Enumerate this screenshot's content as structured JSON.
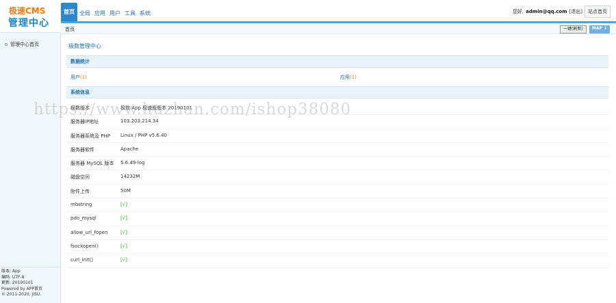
{
  "logo": {
    "line1": "极速CMS",
    "line2": "管理中心"
  },
  "nav": {
    "tabs": [
      "首页",
      "全局",
      "应用",
      "用户",
      "工具",
      "系统"
    ]
  },
  "user_bar": {
    "greeting": "您好,",
    "email": "admin@qq.com",
    "logout": "[退出]",
    "site_home": "站点首页"
  },
  "breadcrumb": {
    "text": "首页"
  },
  "toolbar": {
    "one_click": "一键(刷新)",
    "map": "MAP ⇓"
  },
  "sidebar": {
    "item": "管理中心首页",
    "info": [
      "版本: App",
      "编码: UTF-8",
      "更新: 20190101",
      "Powered by APP首页",
      "© 2011-2020, JISU."
    ]
  },
  "main": {
    "title": "极数管理中心",
    "stats_title": "数据统计",
    "stats": [
      {
        "label": "用户",
        "count": "(1)"
      },
      {
        "label": "应用",
        "count": "(1)"
      }
    ],
    "sys_title": "系统信息",
    "rows": [
      {
        "label": "极数版本",
        "value": "极数 App 极速版版本 20190101",
        "ok": false
      },
      {
        "label": "服务器IP地址",
        "value": "103.203.214.34",
        "ok": false
      },
      {
        "label": "服务器系统及 PHP",
        "value": "Linux / PHP v5.6.40",
        "ok": false
      },
      {
        "label": "服务器软件",
        "value": "Apache",
        "ok": false
      },
      {
        "label": "服务器 MySQL 版本",
        "value": "5.6.49-log",
        "ok": false
      },
      {
        "label": "磁盘空间",
        "value": "14232M",
        "ok": false
      },
      {
        "label": "附件上传",
        "value": "50M",
        "ok": false
      },
      {
        "label": "mbstring",
        "value": "[√]",
        "ok": true
      },
      {
        "label": "pdo_mysql",
        "value": "[√]",
        "ok": true
      },
      {
        "label": "allow_url_fopen",
        "value": "[√]",
        "ok": true
      },
      {
        "label": "fsockopen()",
        "value": "[√]",
        "ok": true
      },
      {
        "label": "curl_init()",
        "value": "[√]",
        "ok": true
      }
    ]
  },
  "watermark": "https://www.huzhan.com/ishop38080"
}
